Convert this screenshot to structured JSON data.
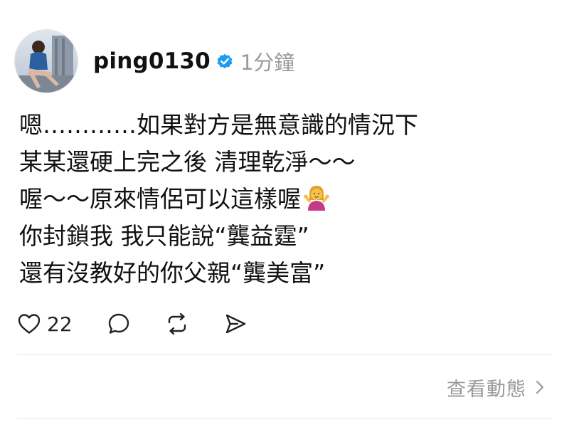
{
  "post": {
    "author": {
      "username": "ping0130",
      "verified": true,
      "verified_color": "#1d9bf0",
      "avatar_icon": "profile-photo"
    },
    "timestamp": "1分鐘",
    "lines": [
      "嗯…………如果對方是無意識的情況下",
      "某某還硬上完之後 清理乾淨～～",
      "喔～～原來情侶可以這樣喔",
      "你封鎖我 我只能說“龔益霆”",
      "還有沒教好的你父親“龔美富”"
    ],
    "line3_emoji": "person-shrugging-emoji",
    "actions": {
      "like_icon": "heart-icon",
      "like_count": "22",
      "comment_icon": "comment-icon",
      "repost_icon": "repost-icon",
      "share_icon": "send-icon"
    },
    "view_activity": {
      "label": "查看動態",
      "icon": "chevron-right-icon"
    }
  },
  "colors": {
    "text": "#111111",
    "muted": "#9a9a9a",
    "divider": "#e6e6e6",
    "verified_blue": "#1d9bf0"
  }
}
